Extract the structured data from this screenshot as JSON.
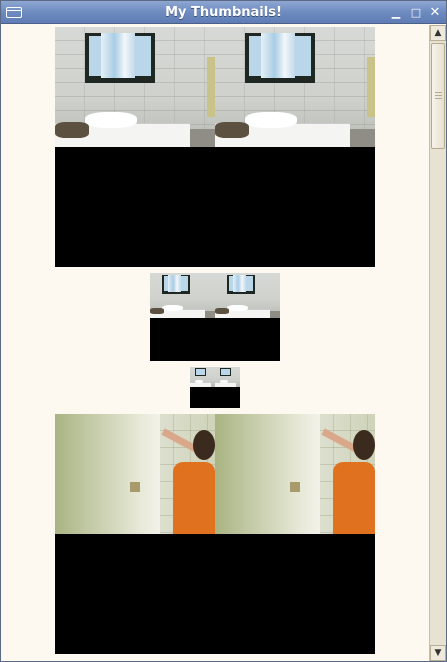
{
  "window": {
    "title": "My Thumbnails!",
    "menu_icon": "window-menu-icon",
    "controls": {
      "minimize_symbol": "▁",
      "maximize_symbol": "□",
      "close_symbol": "✕"
    }
  },
  "thumbnails": [
    {
      "scene": "bedroom",
      "size": "large"
    },
    {
      "scene": "bedroom",
      "size": "medium"
    },
    {
      "scene": "bedroom",
      "size": "small"
    },
    {
      "scene": "bathroom",
      "size": "large"
    }
  ],
  "scrollbar": {
    "up_symbol": "▲",
    "down_symbol": "▼"
  },
  "colors": {
    "titlebar": "#6e8bc0",
    "content_bg": "#fdf8f0",
    "letterbox": "#000000"
  }
}
